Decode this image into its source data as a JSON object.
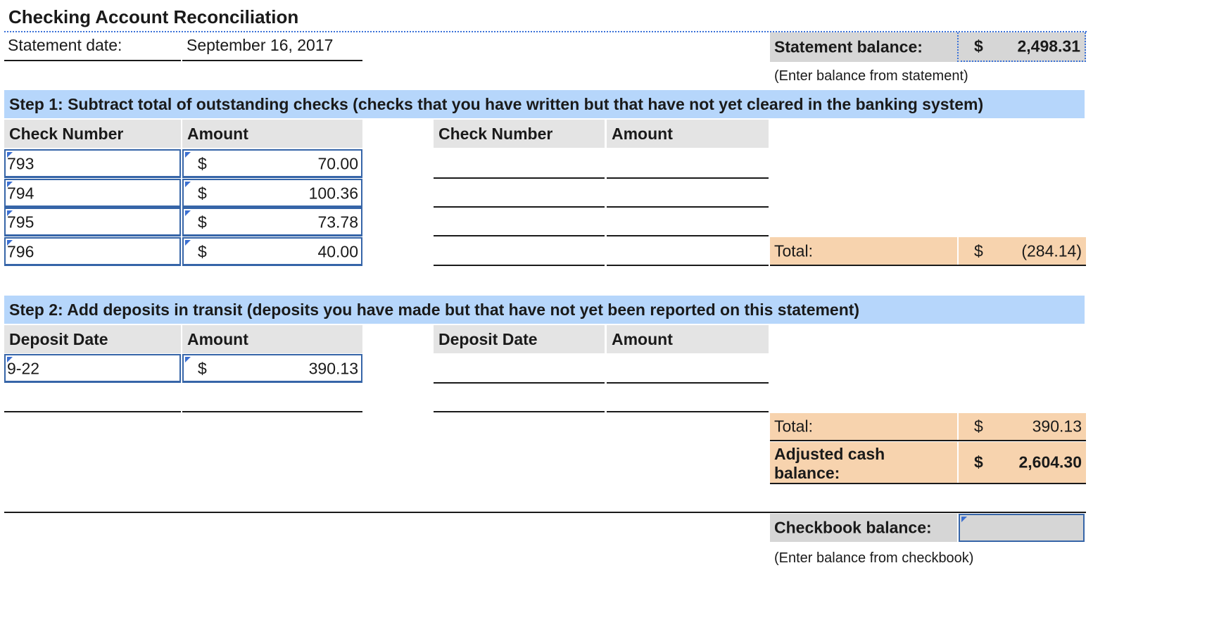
{
  "title": "Checking Account Reconciliation",
  "statement": {
    "date_label": "Statement date:",
    "date_value": "September 16, 2017",
    "balance_label": "Statement balance:",
    "currency": "$",
    "balance_value": "2,498.31",
    "balance_note": "(Enter balance from statement)"
  },
  "step1": {
    "heading": "Step 1: Subtract total of outstanding checks (checks that you have written but that have not yet cleared in the banking system)",
    "col_check": "Check Number",
    "col_amount": "Amount",
    "rows": [
      {
        "number": "793",
        "currency": "$",
        "amount": "70.00"
      },
      {
        "number": "794",
        "currency": "$",
        "amount": "100.36"
      },
      {
        "number": "795",
        "currency": "$",
        "amount": "73.78"
      },
      {
        "number": "796",
        "currency": "$",
        "amount": "40.00"
      }
    ],
    "total_label": "Total:",
    "total_currency": "$",
    "total_value": "(284.14)"
  },
  "step2": {
    "heading": "Step 2: Add deposits in transit (deposits you have made but that have not yet been reported on this statement)",
    "col_date": "Deposit Date",
    "col_amount": "Amount",
    "rows": [
      {
        "date": "9-22",
        "currency": "$",
        "amount": "390.13"
      }
    ],
    "total_label": "Total:",
    "total_currency": "$",
    "total_value": "390.13",
    "adjusted_label": "Adjusted cash balance:",
    "adjusted_currency": "$",
    "adjusted_value": "2,604.30"
  },
  "checkbook": {
    "label": "Checkbook balance:",
    "value": "",
    "note": "(Enter balance from checkbook)"
  },
  "colors": {
    "band": "#b6d6fb",
    "header": "#e4e4e4",
    "total": "#f7d3ae",
    "input_border": "#3665a8"
  }
}
